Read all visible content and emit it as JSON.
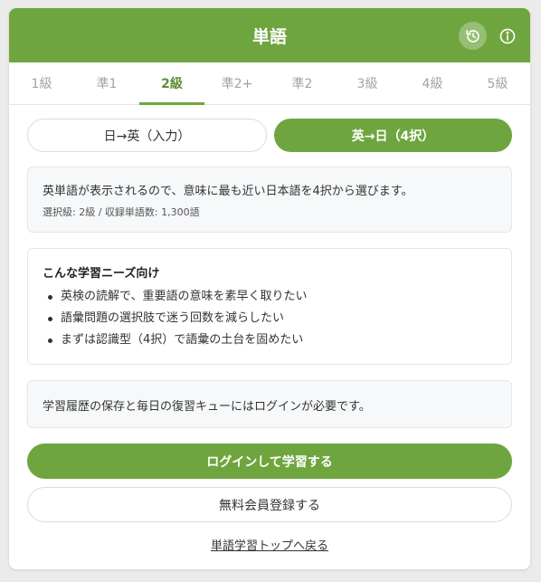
{
  "header": {
    "title": "単語",
    "history_icon": "history-icon",
    "info_icon": "info-icon"
  },
  "tabs": [
    {
      "label": "1級",
      "active": false
    },
    {
      "label": "準1",
      "active": false
    },
    {
      "label": "2級",
      "active": true
    },
    {
      "label": "準2+",
      "active": false
    },
    {
      "label": "準2",
      "active": false
    },
    {
      "label": "3級",
      "active": false
    },
    {
      "label": "4級",
      "active": false
    },
    {
      "label": "5級",
      "active": false
    }
  ],
  "modes": {
    "input": "日→英（入力）",
    "choice": "英→日（4択）",
    "selected": "choice"
  },
  "description": {
    "main": "英単語が表示されるので、意味に最も近い日本語を4択から選びます。",
    "sub": "選択級: 2級 / 収録単語数: 1,300語"
  },
  "needs": {
    "title": "こんな学習ニーズ向け",
    "items": [
      "英検の読解で、重要語の意味を素早く取りたい",
      "語彙問題の選択肢で迷う回数を減らしたい",
      "まずは認識型（4択）で語彙の土台を固めたい"
    ]
  },
  "login_note": "学習履歴の保存と毎日の復習キューにはログインが必要です。",
  "buttons": {
    "login": "ログインして学習する",
    "register": "無料会員登録する",
    "back": "単語学習トップへ戻る"
  },
  "colors": {
    "accent": "#6fa53e",
    "accent_dark": "#5d8f30"
  }
}
